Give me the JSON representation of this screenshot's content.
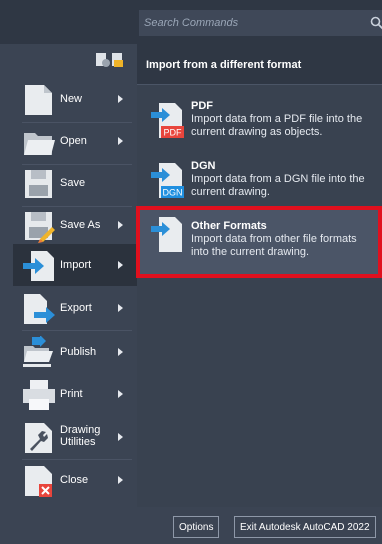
{
  "search": {
    "placeholder": "Search Commands"
  },
  "menu": {
    "items": [
      {
        "label": "New",
        "has_submenu": true
      },
      {
        "label": "Open",
        "has_submenu": true
      },
      {
        "label": "Save",
        "has_submenu": false
      },
      {
        "label": "Save As",
        "has_submenu": true
      },
      {
        "label": "Import",
        "has_submenu": true,
        "active": true
      },
      {
        "label": "Export",
        "has_submenu": true
      },
      {
        "label": "Publish",
        "has_submenu": true
      },
      {
        "label": "Print",
        "has_submenu": true
      },
      {
        "label_line1": "Drawing",
        "label_line2": "Utilities",
        "has_submenu": true
      },
      {
        "label": "Close",
        "has_submenu": true
      }
    ]
  },
  "panel": {
    "header": "Import from a different format",
    "options": [
      {
        "title": "PDF",
        "description": "Import data from a PDF file into the current drawing as objects.",
        "icon": "pdf-import-icon",
        "badge": "PDF"
      },
      {
        "title": "DGN",
        "description": "Import data from a DGN file into the current drawing.",
        "icon": "dgn-import-icon",
        "badge": "DGN"
      },
      {
        "title": "Other Formats",
        "description": "Import data from other file formats into the current drawing.",
        "icon": "other-formats-import-icon",
        "selected": true
      }
    ]
  },
  "footer": {
    "options_label": "Options",
    "exit_label": "Exit Autodesk AutoCAD 2022"
  },
  "colors": {
    "background": "#3b4453",
    "top_strip": "#2f3744",
    "active_item": "#2b323d",
    "selected_option": "#4b5567",
    "highlight_border": "#e0101e",
    "badge_red": "#e8453c",
    "badge_blue": "#1f8fe0"
  }
}
